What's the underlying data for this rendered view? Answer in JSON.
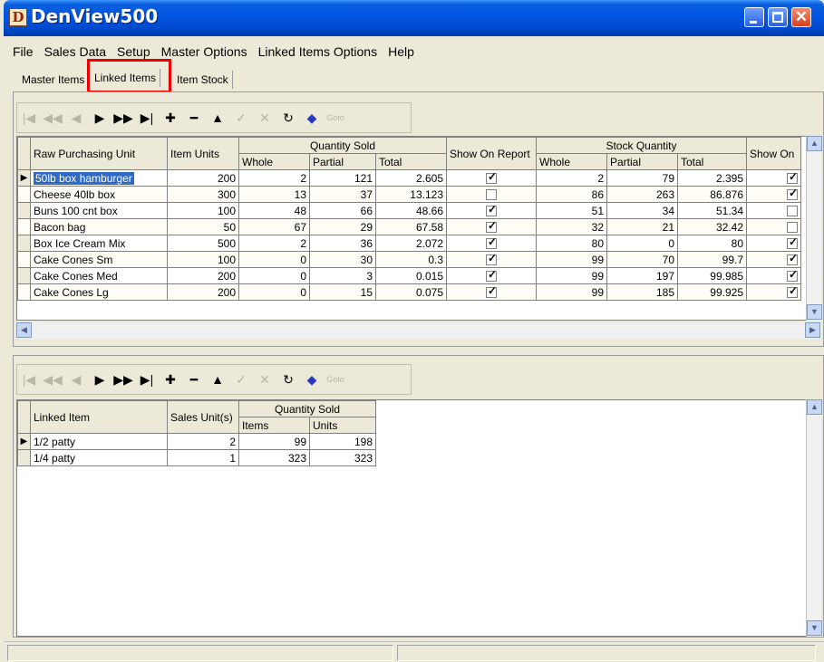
{
  "window": {
    "title": "DenView500",
    "app_icon": "D"
  },
  "menu": [
    "File",
    "Sales Data",
    "Setup",
    "Master Options",
    "Linked Items Options",
    "Help"
  ],
  "tabs": [
    {
      "label": "Master Items",
      "active": false
    },
    {
      "label": "Linked Items",
      "active": true
    },
    {
      "label": "Item Stock",
      "active": false
    }
  ],
  "toolbar_icons": [
    "first-icon",
    "prior-page-icon",
    "prior-icon",
    "next-icon",
    "next-page-icon",
    "last-icon",
    "insert-icon",
    "delete-icon",
    "edit-icon",
    "post-icon",
    "cancel-icon",
    "refresh-icon",
    "apply-icon",
    "goto-icon"
  ],
  "toolbar_goto_label": "Goto",
  "master_grid": {
    "headers": {
      "raw_unit": "Raw Purchasing Unit",
      "item_units": "Item Units",
      "qty_sold": "Quantity Sold",
      "whole": "Whole",
      "partial": "Partial",
      "total": "Total",
      "show_on_report": "Show On Report",
      "stock_qty": "Stock Quantity",
      "stock_whole": "Whole",
      "stock_partial": "Partial",
      "stock_total": "Total",
      "show_on": "Show On"
    },
    "rows": [
      {
        "name": "50lb box hamburger",
        "units": "200",
        "whole": "2",
        "partial": "121",
        "total": "2.605",
        "show_report": true,
        "s_whole": "2",
        "s_partial": "79",
        "s_total": "2.395",
        "show_on": true
      },
      {
        "name": "Cheese 40lb box",
        "units": "300",
        "whole": "13",
        "partial": "37",
        "total": "13.123",
        "show_report": false,
        "s_whole": "86",
        "s_partial": "263",
        "s_total": "86.876",
        "show_on": true
      },
      {
        "name": "Buns 100 cnt box",
        "units": "100",
        "whole": "48",
        "partial": "66",
        "total": "48.66",
        "show_report": true,
        "s_whole": "51",
        "s_partial": "34",
        "s_total": "51.34",
        "show_on": false
      },
      {
        "name": "Bacon bag",
        "units": "50",
        "whole": "67",
        "partial": "29",
        "total": "67.58",
        "show_report": true,
        "s_whole": "32",
        "s_partial": "21",
        "s_total": "32.42",
        "show_on": false
      },
      {
        "name": "Box Ice Cream Mix",
        "units": "500",
        "whole": "2",
        "partial": "36",
        "total": "2.072",
        "show_report": true,
        "s_whole": "80",
        "s_partial": "0",
        "s_total": "80",
        "show_on": true
      },
      {
        "name": "Cake Cones Sm",
        "units": "100",
        "whole": "0",
        "partial": "30",
        "total": "0.3",
        "show_report": true,
        "s_whole": "99",
        "s_partial": "70",
        "s_total": "99.7",
        "show_on": true
      },
      {
        "name": "Cake Cones Med",
        "units": "200",
        "whole": "0",
        "partial": "3",
        "total": "0.015",
        "show_report": true,
        "s_whole": "99",
        "s_partial": "197",
        "s_total": "99.985",
        "show_on": true
      },
      {
        "name": "Cake Cones Lg",
        "units": "200",
        "whole": "0",
        "partial": "15",
        "total": "0.075",
        "show_report": true,
        "s_whole": "99",
        "s_partial": "185",
        "s_total": "99.925",
        "show_on": true
      }
    ]
  },
  "linked_grid": {
    "headers": {
      "linked_item": "Linked Item",
      "sales_units": "Sales Unit(s)",
      "qty_sold": "Quantity Sold",
      "items": "Items",
      "units": "Units"
    },
    "rows": [
      {
        "name": "1/2 patty",
        "sales_units": "2",
        "items": "99",
        "units": "198"
      },
      {
        "name": "1/4 patty",
        "sales_units": "1",
        "items": "323",
        "units": "323"
      }
    ]
  }
}
